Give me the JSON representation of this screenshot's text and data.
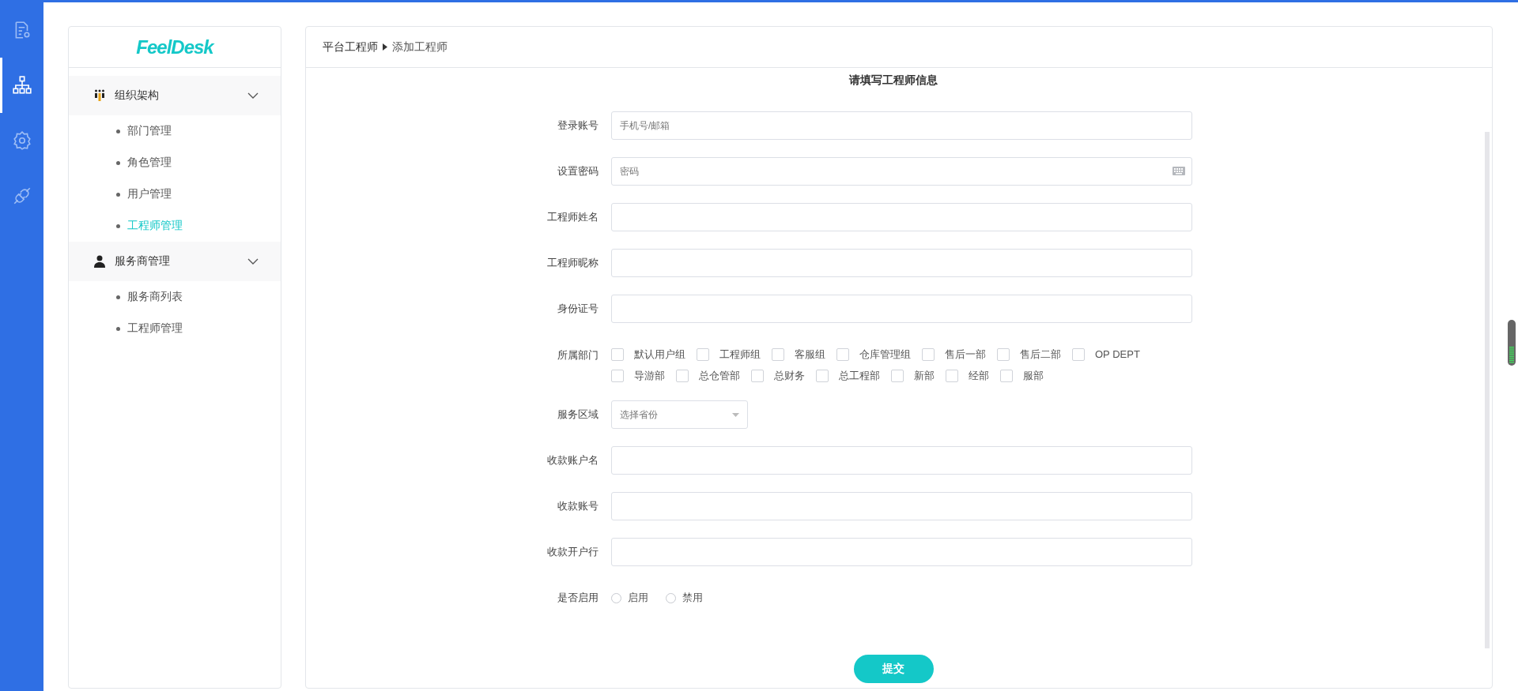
{
  "rail": {
    "items": [
      {
        "selected": false
      },
      {
        "selected": true
      },
      {
        "selected": false
      },
      {
        "selected": false
      }
    ]
  },
  "sidebar": {
    "logo": "FeelDesk",
    "groups": [
      {
        "label": "组织架构",
        "expanded": true,
        "children": [
          {
            "label": "部门管理",
            "selected": false
          },
          {
            "label": "角色管理",
            "selected": false
          },
          {
            "label": "用户管理",
            "selected": false
          },
          {
            "label": "工程师管理",
            "selected": true
          }
        ]
      },
      {
        "label": "服务商管理",
        "expanded": true,
        "children": [
          {
            "label": "服务商列表",
            "selected": false
          },
          {
            "label": "工程师管理",
            "selected": false
          }
        ]
      }
    ]
  },
  "breadcrumb": [
    "平台工程师",
    "添加工程师"
  ],
  "form": {
    "title": "请填写工程师信息",
    "fields": [
      {
        "kind": "text",
        "label": "登录账号",
        "placeholder": "手机号/邮箱"
      },
      {
        "kind": "password",
        "label": "设置密码",
        "placeholder": "密码"
      },
      {
        "kind": "text",
        "label": "工程师姓名"
      },
      {
        "kind": "text",
        "label": "工程师昵称"
      },
      {
        "kind": "text",
        "label": "身份证号"
      },
      {
        "kind": "checkboxes",
        "label": "所属部门",
        "options": [
          {
            "label": "默认用户组",
            "checked": false
          },
          {
            "label": "工程师组",
            "checked": false
          },
          {
            "label": "客服组",
            "checked": false
          },
          {
            "label": "仓库管理组",
            "checked": false
          },
          {
            "label": "售后一部",
            "checked": false
          },
          {
            "label": "售后二部",
            "checked": false
          },
          {
            "label": "OP DEPT",
            "checked": false
          },
          {
            "label": "导游部",
            "checked": false
          },
          {
            "label": "总仓管部",
            "checked": false
          },
          {
            "label": "总财务",
            "checked": false
          },
          {
            "label": "总工程部",
            "checked": false
          },
          {
            "label": "新部",
            "checked": false
          },
          {
            "label": "经部",
            "checked": false
          },
          {
            "label": "服部",
            "checked": false
          }
        ]
      },
      {
        "kind": "select",
        "label": "服务区域",
        "placeholder": "选择省份"
      },
      {
        "kind": "text",
        "label": "收款账户名"
      },
      {
        "kind": "text",
        "label": "收款账号"
      },
      {
        "kind": "text",
        "label": "收款开户行"
      },
      {
        "kind": "radios",
        "label": "是否启用",
        "options": [
          {
            "label": "启用",
            "selected": false
          },
          {
            "label": "禁用",
            "selected": false
          }
        ]
      }
    ],
    "submit": "提交"
  }
}
